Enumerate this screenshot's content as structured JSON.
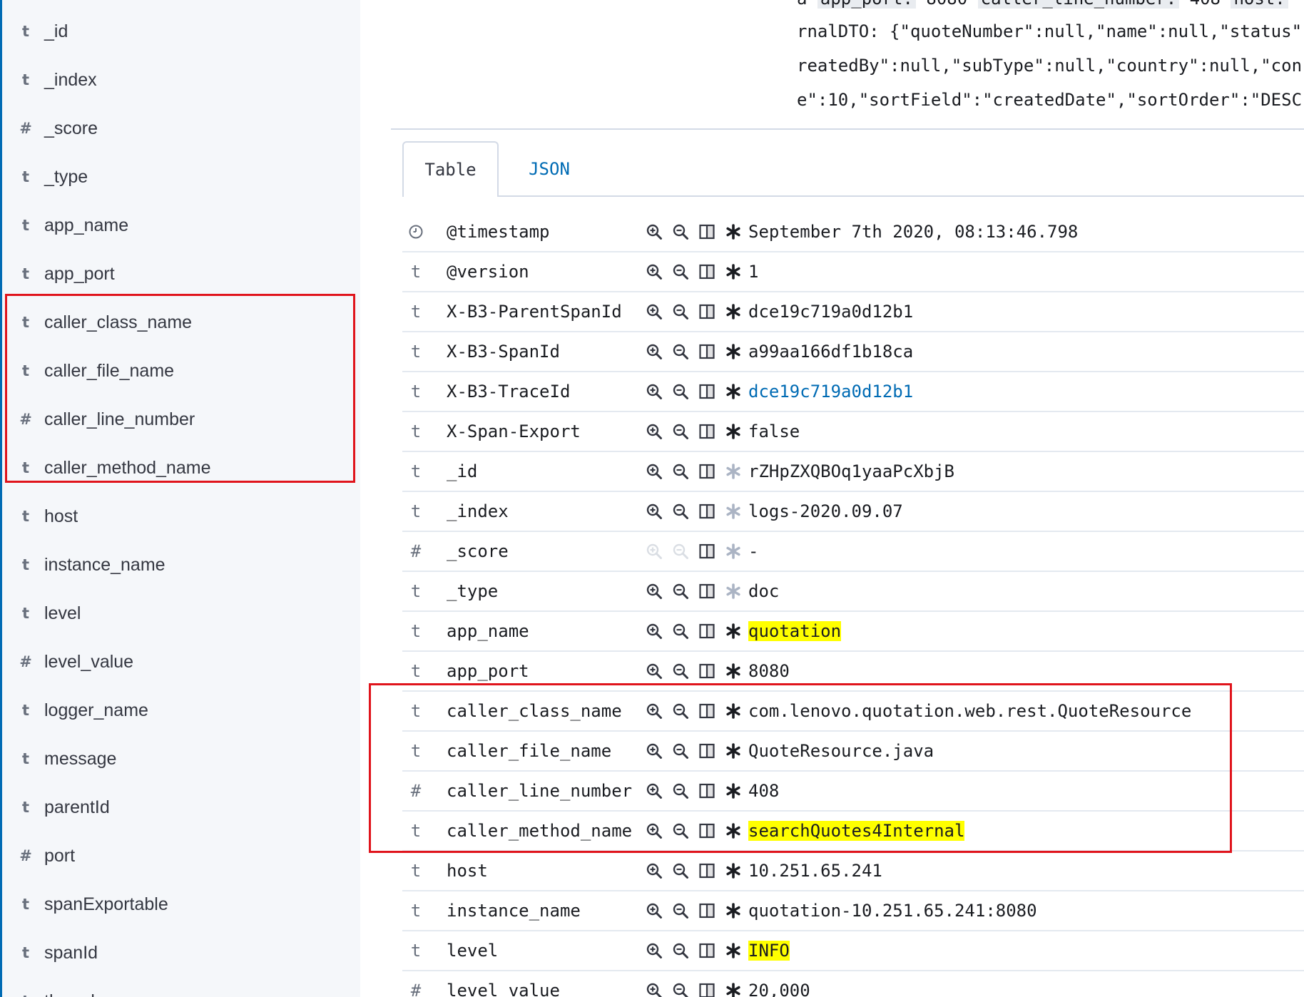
{
  "sidebar": {
    "fields": [
      {
        "type": "t",
        "name": "_id"
      },
      {
        "type": "t",
        "name": "_index"
      },
      {
        "type": "#",
        "name": "_score"
      },
      {
        "type": "t",
        "name": "_type"
      },
      {
        "type": "t",
        "name": "app_name"
      },
      {
        "type": "t",
        "name": "app_port"
      },
      {
        "type": "t",
        "name": "caller_class_name"
      },
      {
        "type": "t",
        "name": "caller_file_name"
      },
      {
        "type": "#",
        "name": "caller_line_number"
      },
      {
        "type": "t",
        "name": "caller_method_name"
      },
      {
        "type": "t",
        "name": "host"
      },
      {
        "type": "t",
        "name": "instance_name"
      },
      {
        "type": "t",
        "name": "level"
      },
      {
        "type": "#",
        "name": "level_value"
      },
      {
        "type": "t",
        "name": "logger_name"
      },
      {
        "type": "t",
        "name": "message"
      },
      {
        "type": "t",
        "name": "parentId"
      },
      {
        "type": "#",
        "name": "port"
      },
      {
        "type": "t",
        "name": "spanExportable"
      },
      {
        "type": "t",
        "name": "spanId"
      },
      {
        "type": "t",
        "name": "thread"
      }
    ]
  },
  "message_preview": {
    "line0_prefix": "a",
    "line0_key1": "app_port:",
    "line0_val1": "8080",
    "line0_key2": "caller_line_number:",
    "line0_val2": "408",
    "line0_key3": "host:",
    "lines": [
      "rnalDTO: {\"quoteNumber\":null,\"name\":null,\"status\":",
      "reatedBy\":null,\"subType\":null,\"country\":null,\"con",
      "e\":10,\"sortField\":\"createdDate\",\"sortOrder\":\"DESC"
    ]
  },
  "tabs": [
    {
      "label": "Table",
      "active": true
    },
    {
      "label": "JSON",
      "active": false
    }
  ],
  "doc_rows": [
    {
      "type": "clock",
      "name": "@timestamp",
      "value": "September 7th 2020, 08:13:46.798",
      "filter": true,
      "exists": "on"
    },
    {
      "type": "t",
      "name": "@version",
      "value": "1",
      "filter": true,
      "exists": "on"
    },
    {
      "type": "t",
      "name": "X-B3-ParentSpanId",
      "value": "dce19c719a0d12b1",
      "filter": true,
      "exists": "on"
    },
    {
      "type": "t",
      "name": "X-B3-SpanId",
      "value": "a99aa166df1b18ca",
      "filter": true,
      "exists": "on"
    },
    {
      "type": "t",
      "name": "X-B3-TraceId",
      "value": "dce19c719a0d12b1",
      "filter": true,
      "exists": "on",
      "link": true
    },
    {
      "type": "t",
      "name": "X-Span-Export",
      "value": "false",
      "filter": true,
      "exists": "on"
    },
    {
      "type": "t",
      "name": "_id",
      "value": "rZHpZXQBOq1yaaPcXbjB",
      "filter": true,
      "exists": "off"
    },
    {
      "type": "t",
      "name": "_index",
      "value": "logs-2020.09.07",
      "filter": true,
      "exists": "off"
    },
    {
      "type": "#",
      "name": "_score",
      "value": " -",
      "filter": false,
      "exists": "off"
    },
    {
      "type": "t",
      "name": "_type",
      "value": "doc",
      "filter": true,
      "exists": "off"
    },
    {
      "type": "t",
      "name": "app_name",
      "value": "quotation",
      "filter": true,
      "exists": "on",
      "highlight": true
    },
    {
      "type": "t",
      "name": "app_port",
      "value": "8080",
      "filter": true,
      "exists": "on"
    },
    {
      "type": "t",
      "name": "caller_class_name",
      "value": "com.lenovo.quotation.web.rest.QuoteResource",
      "filter": true,
      "exists": "on"
    },
    {
      "type": "t",
      "name": "caller_file_name",
      "value": "QuoteResource.java",
      "filter": true,
      "exists": "on"
    },
    {
      "type": "#",
      "name": "caller_line_number",
      "value": "408",
      "filter": true,
      "exists": "on"
    },
    {
      "type": "t",
      "name": "caller_method_name",
      "value": "searchQuotes4Internal",
      "filter": true,
      "exists": "on",
      "highlight": true
    },
    {
      "type": "t",
      "name": "host",
      "value": "10.251.65.241",
      "filter": true,
      "exists": "on"
    },
    {
      "type": "t",
      "name": "instance_name",
      "value": "quotation-10.251.65.241:8080",
      "filter": true,
      "exists": "on"
    },
    {
      "type": "t",
      "name": "level",
      "value": "INFO",
      "filter": true,
      "exists": "on",
      "highlight": true
    },
    {
      "type": "#",
      "name": "level_value",
      "value": "20,000",
      "filter": true,
      "exists": "on"
    }
  ],
  "colors": {
    "accent": "#006bb4",
    "highlight": "#ffff00",
    "annotation_box": "#e0141c",
    "sidebar_bg": "#f5f7fa"
  }
}
